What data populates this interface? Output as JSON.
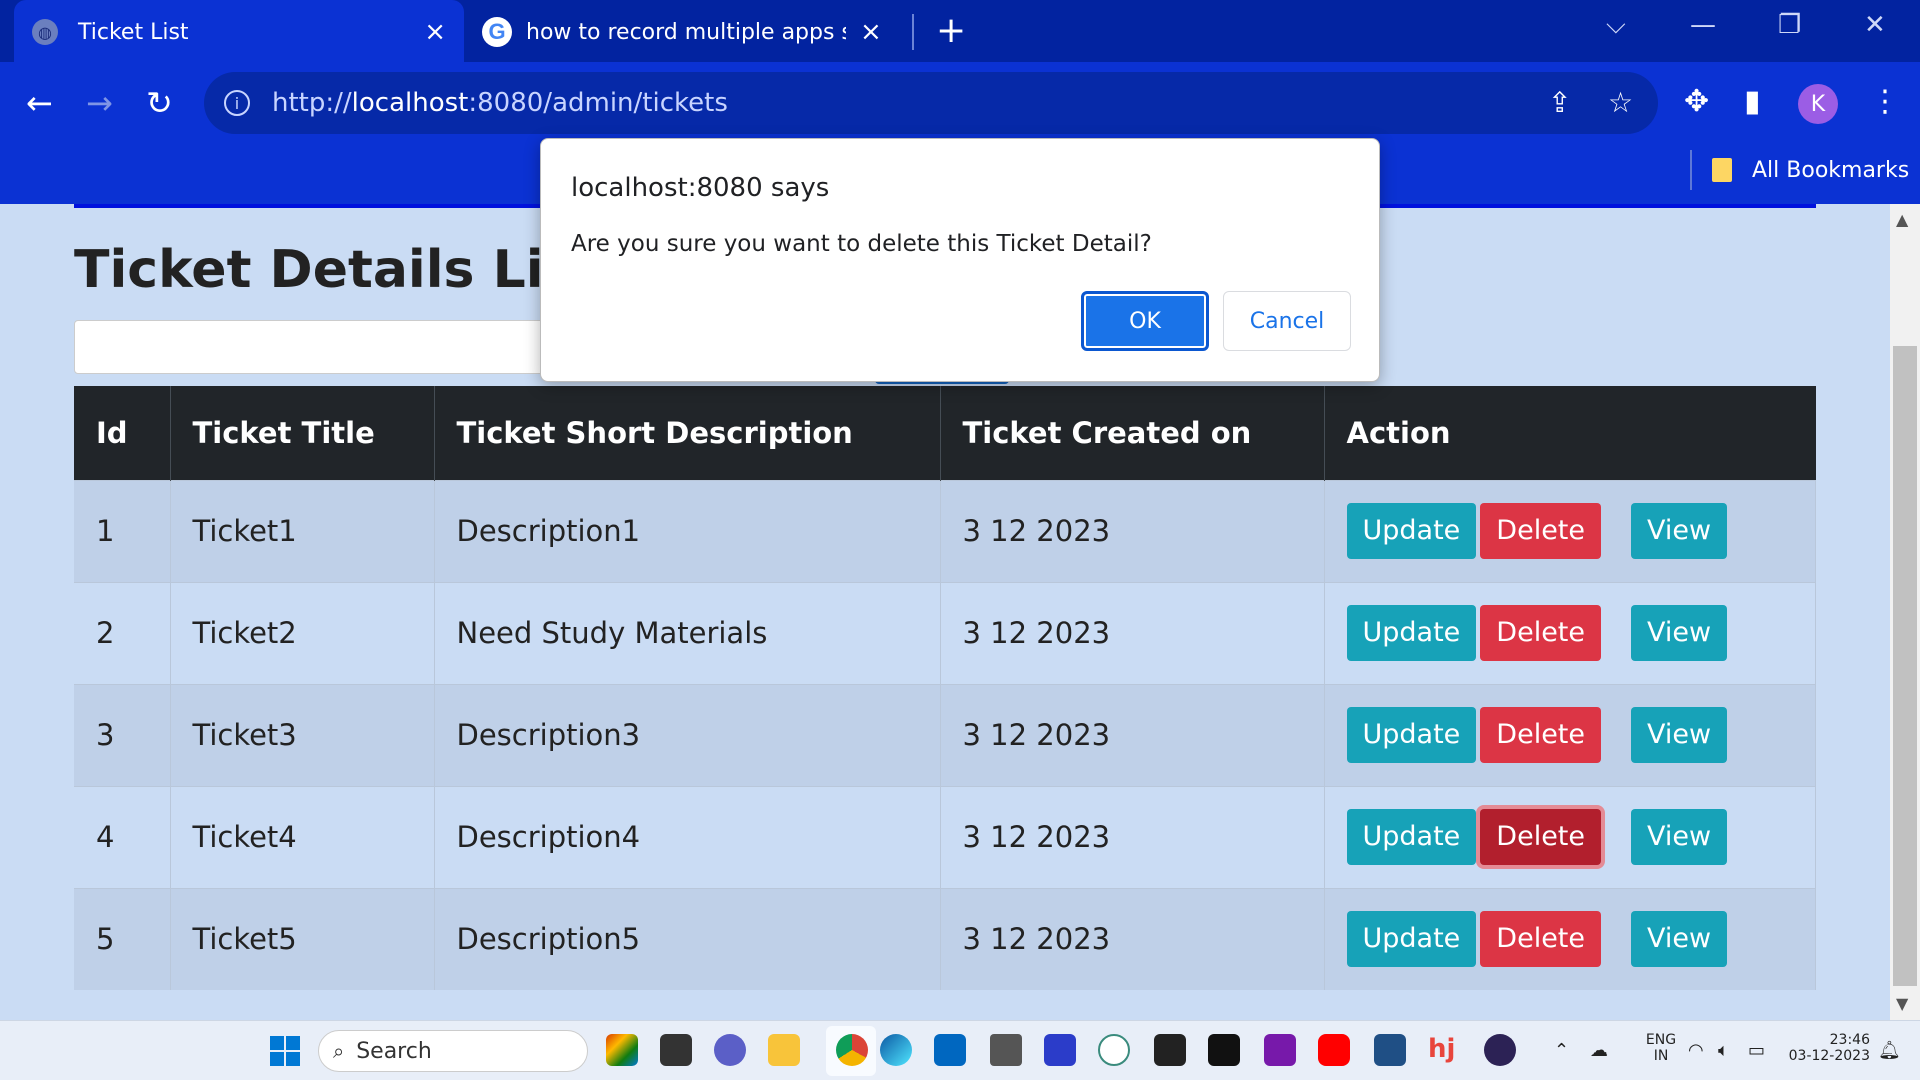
{
  "browser": {
    "tabs": [
      {
        "title": "Ticket List",
        "active": true
      },
      {
        "title": "how to record multiple apps scre",
        "active": false
      }
    ],
    "url_protocol": "http://",
    "url_host": "localhost",
    "url_path": ":8080/admin/tickets",
    "bookmarks_label": "All Bookmarks",
    "profile_initial": "K"
  },
  "page": {
    "title": "Ticket Details List",
    "table": {
      "headers": [
        "Id",
        "Ticket Title",
        "Ticket Short Description",
        "Ticket Created on",
        "Action"
      ],
      "rows": [
        {
          "id": "1",
          "title": "Ticket1",
          "desc": "Description1",
          "created": "3 12 2023"
        },
        {
          "id": "2",
          "title": "Ticket2",
          "desc": "Need Study Materials",
          "created": "3 12 2023"
        },
        {
          "id": "3",
          "title": "Ticket3",
          "desc": "Description3",
          "created": "3 12 2023"
        },
        {
          "id": "4",
          "title": "Ticket4",
          "desc": "Description4",
          "created": "3 12 2023"
        },
        {
          "id": "5",
          "title": "Ticket5",
          "desc": "Description5",
          "created": "3 12 2023"
        }
      ],
      "actions": {
        "update": "Update",
        "delete": "Delete",
        "view": "View"
      }
    }
  },
  "dialog": {
    "origin": "localhost:8080 says",
    "message": "Are you sure you want to delete this Ticket Detail?",
    "ok": "OK",
    "cancel": "Cancel"
  },
  "taskbar": {
    "search_placeholder": "Search",
    "lang_top": "ENG",
    "lang_bottom": "IN",
    "time": "23:46",
    "date": "03-12-2023"
  },
  "colors": {
    "update": "#17a2b8",
    "delete": "#dc3545",
    "header_bg": "#212529",
    "toolbar": "#0b32d3",
    "dialog_ok": "#1a73e8"
  }
}
